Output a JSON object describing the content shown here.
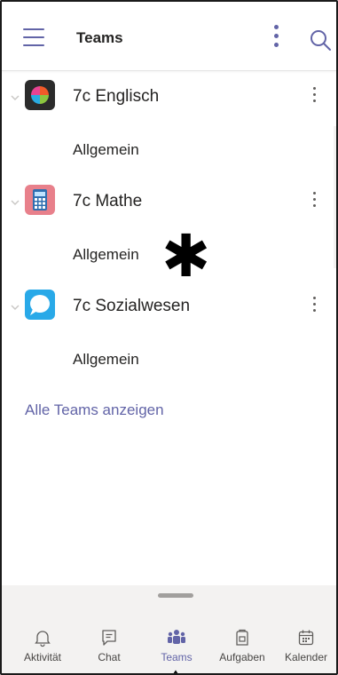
{
  "header": {
    "title": "Teams",
    "menu_icon": "hamburger-icon",
    "more_icon": "more-vertical-icon",
    "search_icon": "search-icon"
  },
  "teams": [
    {
      "name": "7c Englisch",
      "channel": "Allgemein",
      "avatar_icon": "pie-chart-icon",
      "avatar_color": "#2b2b2b"
    },
    {
      "name": "7c Mathe",
      "channel": "Allgemein",
      "avatar_icon": "calculator-icon",
      "avatar_color": "#e8808b"
    },
    {
      "name": "7c Sozialwesen",
      "channel": "Allgemein",
      "avatar_icon": "speech-bubble-icon",
      "avatar_color": "#29a9e8"
    }
  ],
  "links": {
    "all_teams": "Alle Teams anzeigen"
  },
  "annotation": {
    "marker": "✱"
  },
  "bottom_nav": [
    {
      "label": "Aktivität",
      "icon": "bell-icon",
      "active": false
    },
    {
      "label": "Chat",
      "icon": "chat-icon",
      "active": false
    },
    {
      "label": "Teams",
      "icon": "teams-icon",
      "active": true
    },
    {
      "label": "Aufgaben",
      "icon": "assignments-icon",
      "active": false
    },
    {
      "label": "Kalender",
      "icon": "calendar-icon",
      "active": false
    }
  ],
  "colors": {
    "accent": "#6264a7",
    "text": "#252423",
    "nav_bg": "#f3f2f1"
  }
}
